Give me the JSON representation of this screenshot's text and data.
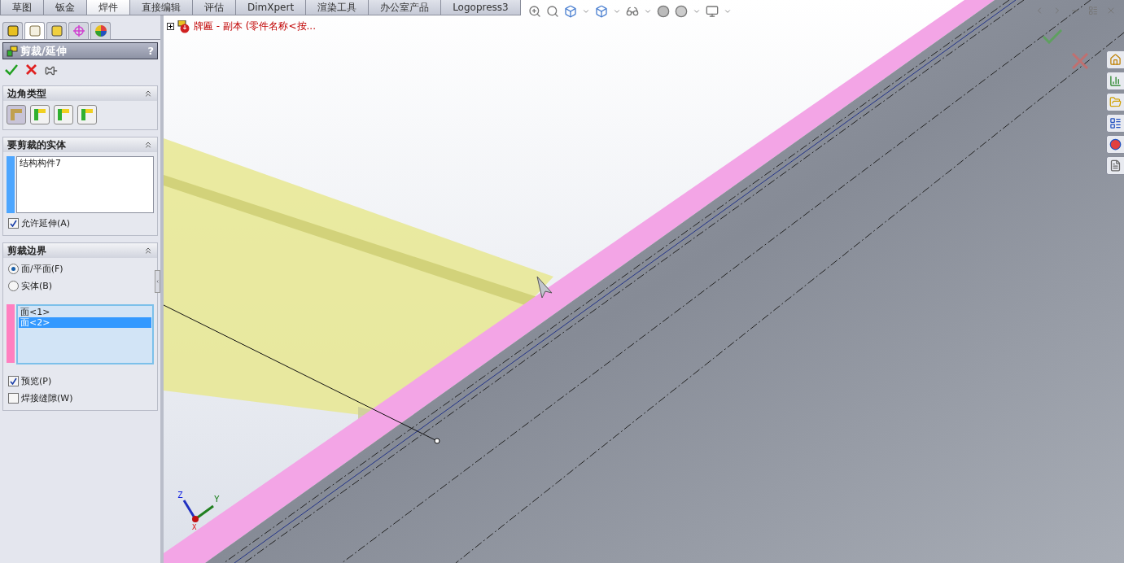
{
  "tabs": [
    {
      "label": "草图",
      "selected": false
    },
    {
      "label": "钣金",
      "selected": false
    },
    {
      "label": "焊件",
      "selected": true
    },
    {
      "label": "直接编辑",
      "selected": false
    },
    {
      "label": "评估",
      "selected": false
    },
    {
      "label": "DimXpert",
      "selected": false
    },
    {
      "label": "渲染工具",
      "selected": false
    },
    {
      "label": "办公室产品",
      "selected": false
    },
    {
      "label": "Logopress3",
      "selected": false
    }
  ],
  "panel_tabs": [
    {
      "kind": "feature",
      "selected": false
    },
    {
      "kind": "property",
      "selected": true
    },
    {
      "kind": "config",
      "selected": false
    },
    {
      "kind": "target",
      "selected": false
    },
    {
      "kind": "display",
      "selected": false
    }
  ],
  "property_manager": {
    "title": "剪裁/延伸",
    "help": "?",
    "corner_type": {
      "title": "边角类型",
      "options": [
        {
          "kind": "end-trim",
          "selected": true
        },
        {
          "kind": "miter",
          "selected": false
        },
        {
          "kind": "butt-1",
          "selected": false
        },
        {
          "kind": "butt-2",
          "selected": false
        }
      ]
    },
    "bodies_to_trim": {
      "title": "要剪裁的实体",
      "color": "#4da6ff",
      "items": [
        {
          "label": "结构构件7",
          "selected": false
        }
      ],
      "checkboxes": [
        {
          "label": "允许延伸(A)",
          "checked": true
        }
      ]
    },
    "trim_boundary": {
      "title": "剪裁边界",
      "radios": [
        {
          "label": "面/平面(F)",
          "selected": true
        },
        {
          "label": "实体(B)",
          "selected": false
        }
      ],
      "color": "#ff80c0",
      "items": [
        {
          "label": "面<1>",
          "selected": false
        },
        {
          "label": "面<2>",
          "selected": true
        }
      ],
      "checkboxes": [
        {
          "label": "预览(P)",
          "checked": true
        },
        {
          "label": "焊接缝隙(W)",
          "checked": false
        }
      ]
    }
  },
  "feature_tree": {
    "label": "牌匾 - 副本  (零件名称<按..."
  },
  "triad": {
    "x": "X",
    "y": "Y",
    "z": "Z"
  }
}
